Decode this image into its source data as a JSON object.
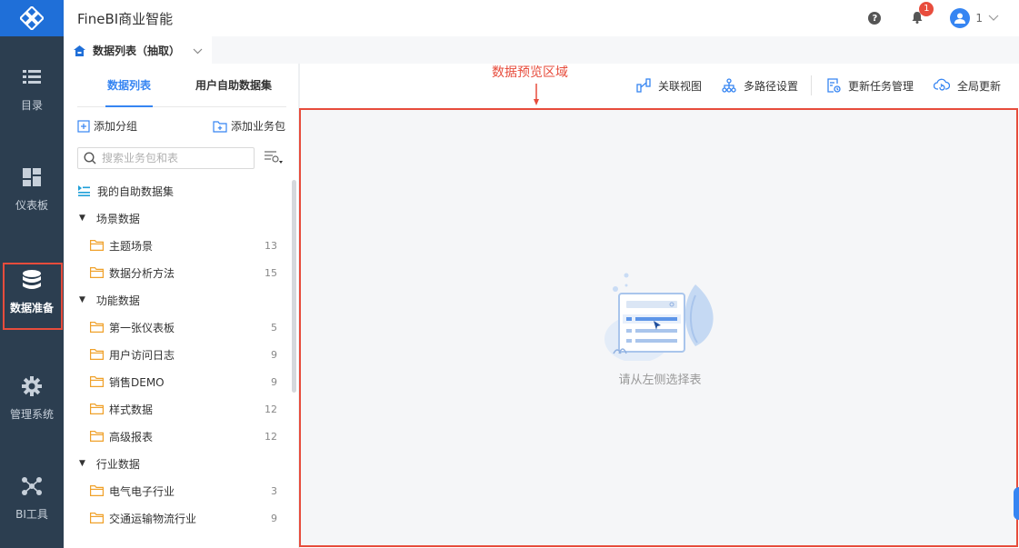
{
  "app": {
    "title": "FineBI商业智能"
  },
  "colors": {
    "nav_bg": "#2c3e50",
    "brand": "#1f6fd8",
    "accent": "#3685f2",
    "annotation": "#e74c3c",
    "badge": "#e84d3d"
  },
  "nav": {
    "items": [
      {
        "label": "目录",
        "icon": "list-icon"
      },
      {
        "label": "仪表板",
        "icon": "dashboard-icon"
      },
      {
        "label": "数据准备",
        "icon": "database-icon",
        "active": true
      },
      {
        "label": "管理系统",
        "icon": "gear-icon"
      },
      {
        "label": "BI工具",
        "icon": "network-icon"
      }
    ]
  },
  "header": {
    "help": "?",
    "notifications": "1",
    "user": "1"
  },
  "breadcrumb": {
    "label": "数据列表（抽取）"
  },
  "panel": {
    "tabs": [
      "数据列表",
      "用户自助数据集"
    ],
    "actions": {
      "add_group": "添加分组",
      "add_package": "添加业务包"
    },
    "search_placeholder": "搜索业务包和表",
    "tree": [
      {
        "type": "special",
        "label": "我的自助数据集"
      },
      {
        "type": "group",
        "label": "场景数据"
      },
      {
        "type": "leaf",
        "label": "主题场景",
        "count": "13"
      },
      {
        "type": "leaf",
        "label": "数据分析方法",
        "count": "15"
      },
      {
        "type": "group",
        "label": "功能数据"
      },
      {
        "type": "leaf",
        "label": "第一张仪表板",
        "count": "5"
      },
      {
        "type": "leaf",
        "label": "用户访问日志",
        "count": "9"
      },
      {
        "type": "leaf",
        "label": "销售DEMO",
        "count": "9"
      },
      {
        "type": "leaf",
        "label": "样式数据",
        "count": "12"
      },
      {
        "type": "leaf",
        "label": "高级报表",
        "count": "12"
      },
      {
        "type": "group",
        "label": "行业数据"
      },
      {
        "type": "leaf",
        "label": "电气电子行业",
        "count": "3"
      },
      {
        "type": "leaf",
        "label": "交通运输物流行业",
        "count": "9"
      }
    ]
  },
  "toolbar": {
    "relation_view": "关联视图",
    "multipath": "多路径设置",
    "update_tasks": "更新任务管理",
    "global_update": "全局更新"
  },
  "preview": {
    "annotation": "数据预览区域",
    "empty_text": "请从左侧选择表"
  }
}
